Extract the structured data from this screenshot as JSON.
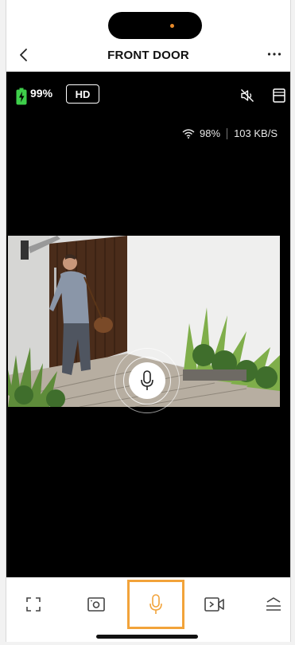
{
  "header": {
    "title": "FRONT DOOR",
    "back_icon": "chevron-left-icon",
    "more_icon": "more-horizontal-icon"
  },
  "status": {
    "battery_percent": "99%",
    "battery_color": "#3ecf4a",
    "quality_badge": "HD",
    "wifi_signal": "98%",
    "bitrate": "103 KB/S"
  },
  "controls": {
    "mute_icon": "speaker-muted-icon",
    "layout_icon": "layout-split-icon",
    "talk_icon": "microphone-icon"
  },
  "toolbar": {
    "items": [
      {
        "name": "fullscreen",
        "icon": "fullscreen-icon"
      },
      {
        "name": "snapshot",
        "icon": "camera-snapshot-icon"
      },
      {
        "name": "talk",
        "icon": "microphone-icon",
        "active": true
      },
      {
        "name": "record",
        "icon": "record-video-icon"
      },
      {
        "name": "more-panel",
        "icon": "chevron-up-panel-icon"
      }
    ],
    "active_color": "#f2a33a"
  }
}
